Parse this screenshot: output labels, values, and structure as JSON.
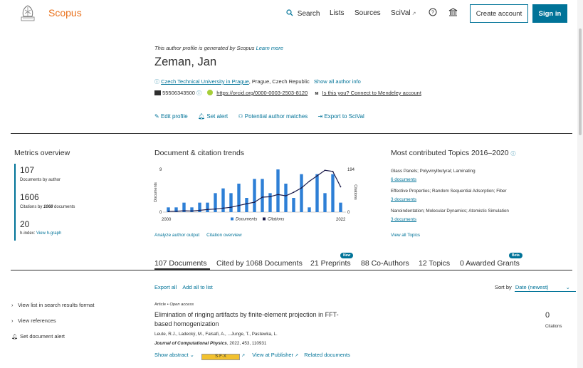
{
  "header": {
    "brand": "Scopus",
    "nav": {
      "search": "Search",
      "lists": "Lists",
      "sources": "Sources",
      "scival": "SciVal"
    },
    "create_account": "Create account",
    "sign_in": "Sign in"
  },
  "profile": {
    "generated_note": "This author profile is generated by Scopus",
    "learn_more": "Learn more",
    "name": "Zeman, Jan",
    "affiliation": "Czech Technical University in Prague",
    "location": ", Prague, Czech Republic",
    "show_all_info": "Show all author info",
    "author_id": "55506343500",
    "orcid": "https://orcid.org/0000-0003-2503-8120",
    "mendeley": "Is this you? Connect to Mendeley account",
    "actions": {
      "edit_profile": "Edit profile",
      "set_alert": "Set alert",
      "potential_matches": "Potential author matches",
      "export_scival": "Export to SciVal"
    }
  },
  "metrics": {
    "title": "Metrics overview",
    "documents_value": "107",
    "documents_label": "Documents by author",
    "citations_value": "1606",
    "citations_label_pre": "Citations by ",
    "citations_label_bold": "1068",
    "citations_label_post": " documents",
    "hindex_value": "20",
    "hindex_label": "h-index:",
    "hindex_link": "View h-graph"
  },
  "trends": {
    "title": "Document & citation trends",
    "analyze_link": "Analyze author output",
    "citation_overview_link": "Citation overview"
  },
  "chart_data": {
    "type": "bar",
    "x_start": 2000,
    "x_end": 2022,
    "xtick_labels": [
      "2000",
      "2022"
    ],
    "ylabel_left": "Documents",
    "ylabel_right": "Citations",
    "ylim_left": [
      0,
      9
    ],
    "ylim_right": [
      0,
      194
    ],
    "yticks_left": [
      "9",
      "0"
    ],
    "yticks_right": [
      "194",
      "0"
    ],
    "legend": [
      "Documents",
      "Citations"
    ],
    "legend_position": "bottom",
    "categories": [
      "2000",
      "2001",
      "2002",
      "2003",
      "2004",
      "2005",
      "2006",
      "2007",
      "2008",
      "2009",
      "2010",
      "2011",
      "2012",
      "2013",
      "2014",
      "2015",
      "2016",
      "2017",
      "2018",
      "2019",
      "2020",
      "2021",
      "2022"
    ],
    "series": [
      {
        "name": "Documents",
        "kind": "bar",
        "color": "#2e7fd6",
        "values": [
          1,
          1,
          2,
          1,
          2,
          2,
          4,
          5,
          4,
          6,
          3,
          7,
          7,
          4,
          9,
          6,
          3,
          8,
          1,
          8,
          4,
          8,
          2
        ]
      },
      {
        "name": "Citations",
        "kind": "line",
        "color": "#1b1b4b",
        "values": [
          3,
          4,
          6,
          5,
          8,
          12,
          14,
          18,
          22,
          30,
          38,
          45,
          68,
          70,
          80,
          74,
          90,
          110,
          140,
          165,
          190,
          185,
          115
        ]
      }
    ]
  },
  "topics": {
    "title": "Most contributed Topics 2016–2020",
    "items": [
      {
        "name": "Glass Panels; Polyvinylbutyral; Laminating",
        "docs": "6 documents"
      },
      {
        "name": "Effective Properties; Random Sequential Adsorption; Fiber",
        "docs": "3 documents"
      },
      {
        "name": "Nanoindentation; Molecular Dynamics; Atomistic Simulation",
        "docs": "3 documents"
      }
    ],
    "view_all": "View all Topics"
  },
  "tabs": [
    {
      "label": "107 Documents"
    },
    {
      "label": "Cited by 1068 Documents"
    },
    {
      "label": "21 Preprints",
      "badge": "New"
    },
    {
      "label": "88 Co-Authors"
    },
    {
      "label": "12 Topics"
    },
    {
      "label": "0 Awarded Grants",
      "badge": "Beta"
    }
  ],
  "sidebar": {
    "list_results": "View list in search results format",
    "references": "View references",
    "alert": "Set document alert"
  },
  "doclist": {
    "export_all": "Export all",
    "add_all": "Add all to list",
    "sort_by": "Sort by",
    "sort_value": "Date (newest)"
  },
  "document": {
    "type": "Article",
    "access": "Open access",
    "title_line1": "Elimination of ringing artifacts by finite-element projection in FFT-",
    "title_line2": "based homogenization",
    "authors": "Leute, R.J., Ladecký, M., Falsafi, A., ...Junge, T., Pastewka, L.",
    "journal": "Journal of Computational Physics",
    "journal_details": ", 2022, 453, 110931",
    "show_abstract": "Show abstract",
    "sfx_label": "S·F·X",
    "view_publisher": "View at Publisher",
    "related": "Related documents",
    "citations_value": "0",
    "citations_label": "Citations"
  },
  "colors": {
    "accent": "#007398",
    "brand": "#e9711c",
    "bar": "#2e7fd6",
    "line": "#1b1b4b"
  }
}
